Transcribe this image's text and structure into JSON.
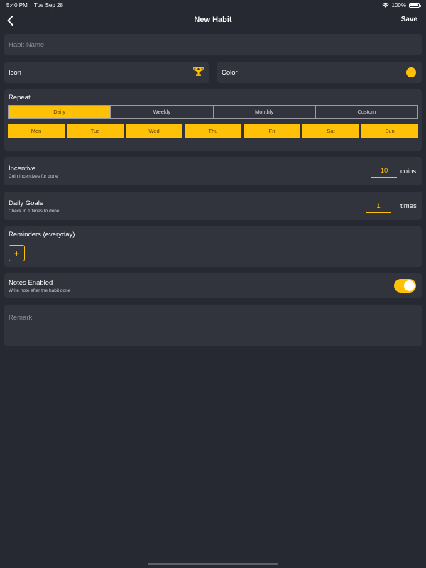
{
  "status": {
    "time": "5:40 PM",
    "date": "Tue Sep 28",
    "battery": "100%"
  },
  "nav": {
    "title": "New Habit",
    "save_label": "Save"
  },
  "habit_name": {
    "placeholder": "Habit Name"
  },
  "icon": {
    "label": "Icon",
    "icon_name": "trophy-icon"
  },
  "color": {
    "label": "Color",
    "value": "#ffc107"
  },
  "repeat": {
    "label": "Repeat",
    "options": [
      "Daily",
      "Weekly",
      "Monthly",
      "Custom"
    ],
    "selected": "Daily",
    "days": [
      "Mon",
      "Tue",
      "Wed",
      "Thu",
      "Fri",
      "Sat",
      "Sun"
    ]
  },
  "incentive": {
    "label": "Incentive",
    "sublabel": "Coin incentives for done",
    "value": "10",
    "unit": "coins"
  },
  "daily_goals": {
    "label": "Daily Goals",
    "sublabel": "Check in 1 times to done",
    "value": "1",
    "unit": "times"
  },
  "reminders": {
    "label": "Reminders (everyday)",
    "add_label": "+"
  },
  "notes": {
    "label": "Notes Enabled",
    "sublabel": "Write note after the habit done",
    "enabled": true
  },
  "remark": {
    "placeholder": "Remark"
  },
  "colors": {
    "background": "#272932",
    "card": "#31333d",
    "accent": "#ffc107"
  }
}
